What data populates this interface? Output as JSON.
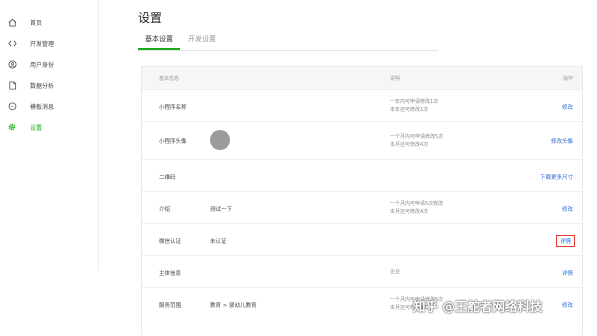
{
  "sidebar": {
    "items": [
      {
        "label": "首页",
        "icon": "home-icon"
      },
      {
        "label": "开发管理",
        "icon": "code-icon"
      },
      {
        "label": "用户身份",
        "icon": "user-icon"
      },
      {
        "label": "数据分析",
        "icon": "document-icon"
      },
      {
        "label": "模板消息",
        "icon": "message-icon"
      },
      {
        "label": "设置",
        "icon": "gear-icon",
        "active": true
      }
    ]
  },
  "page": {
    "title": "设置",
    "tabs": [
      {
        "label": "基本设置",
        "active": true
      },
      {
        "label": "开发设置",
        "active": false
      }
    ]
  },
  "table": {
    "headers": {
      "info": "基本信息",
      "desc": "说明",
      "op": "操作"
    },
    "rows": [
      {
        "label": "小程序名称",
        "value": "",
        "desc1": "一年内可申请修改1次",
        "desc2": "本年还可修改1次",
        "op": "修改"
      },
      {
        "label": "小程序头像",
        "value": "",
        "desc1": "一个月内可申请修改5次",
        "desc2": "本月还可修改4次",
        "op": "修改头像"
      },
      {
        "label": "二维码",
        "value": "",
        "desc1": "",
        "desc2": "",
        "op": "下载更多尺寸"
      },
      {
        "label": "介绍",
        "value": "测试一下",
        "desc1": "一个月内可申请5次修改",
        "desc2": "本月还可修改4次",
        "op": "修改"
      },
      {
        "label": "微信认证",
        "value": "未认证",
        "desc1": "",
        "desc2": "",
        "op": "详情"
      },
      {
        "label": "主体信息",
        "value": "",
        "desc1": "企业",
        "desc2": "",
        "op": "详情"
      },
      {
        "label": "服务范围",
        "value": "教育 > 婴幼儿教育",
        "desc1": "一个月内可申请修改5次",
        "desc2": "本月还可修改4次",
        "op": "修改"
      }
    ]
  },
  "watermark": "知乎 @王舵者网络科技",
  "colors": {
    "accent": "#1aad19",
    "link": "#2a6bd6",
    "highlight_border": "#e53935"
  }
}
